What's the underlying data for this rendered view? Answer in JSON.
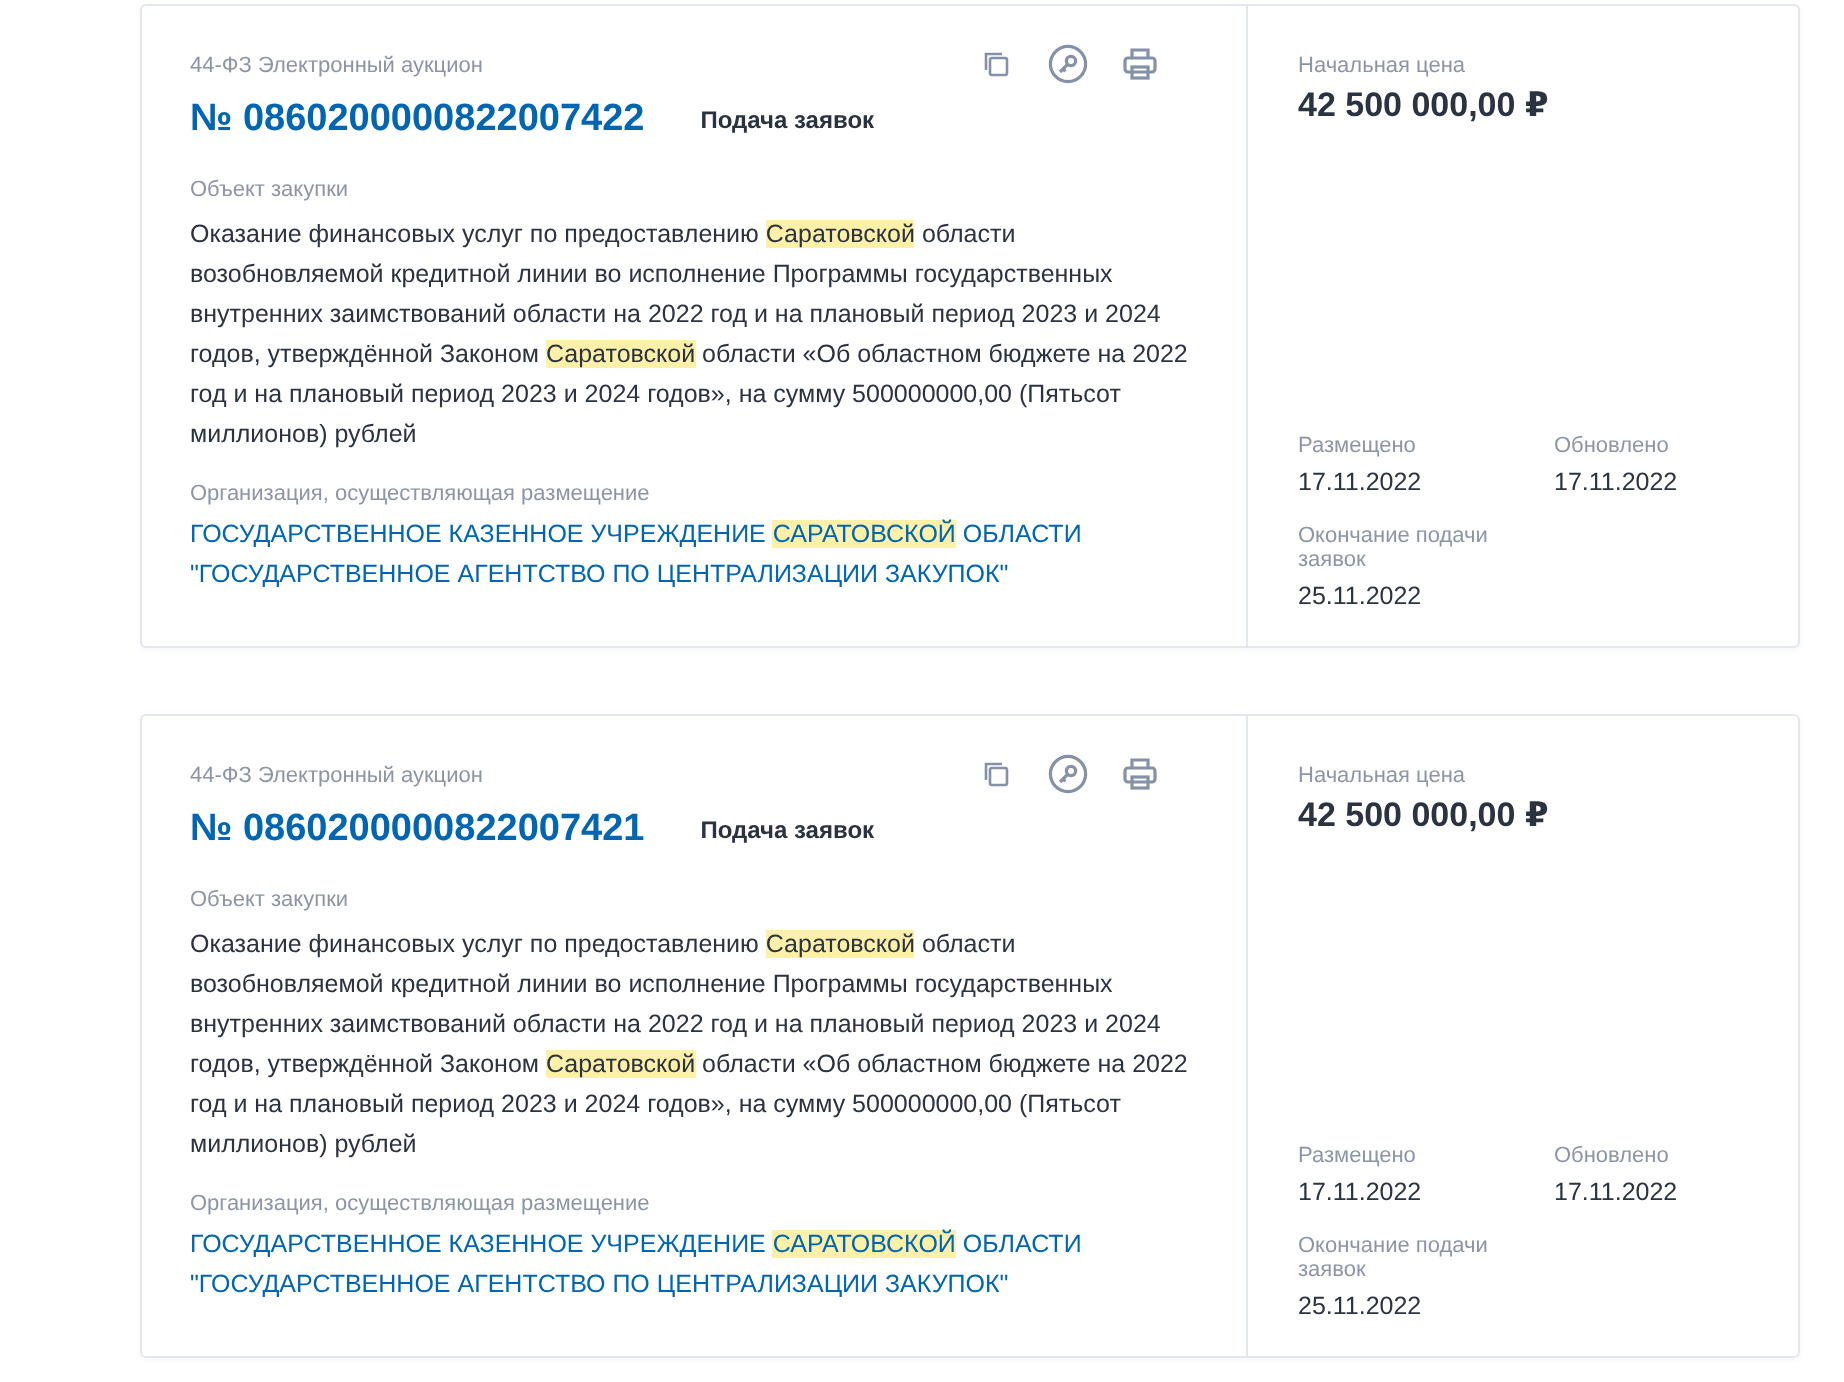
{
  "cards": [
    {
      "law_type": "44-ФЗ Электронный аукцион",
      "number": "№ 0860200000822007422",
      "stage": "Подача заявок",
      "object_label": "Объект закупки",
      "object": [
        {
          "text": "Оказание финансовых услуг по предоставлению ",
          "highlighted": false
        },
        {
          "text": "Саратовской",
          "highlighted": true
        },
        {
          "text": " области возобновляемой кредитной линии во исполнение Программы государственных внутренних заимствований области на 2022 год и на плановый период 2023 и 2024 годов, утверждённой Законом ",
          "highlighted": false
        },
        {
          "text": "Саратовской",
          "highlighted": true
        },
        {
          "text": " области «Об областном бюджете на 2022 год и на плановый период 2023 и 2024 годов», на сумму 500000000,00 (Пятьсот миллионов) рублей",
          "highlighted": false
        }
      ],
      "org_label": "Организация, осуществляющая размещение",
      "org": [
        {
          "text": "ГОСУДАРСТВЕННОЕ КАЗЕННОЕ УЧРЕЖДЕНИЕ ",
          "highlighted": false
        },
        {
          "text": "САРАТОВСКОЙ",
          "highlighted": true
        },
        {
          "text": " ОБЛАСТИ \"ГОСУДАРСТВЕННОЕ АГЕНТСТВО ПО ЦЕНТРАЛИЗАЦИИ ЗАКУПОК\"",
          "highlighted": false
        }
      ],
      "price_label": "Начальная цена",
      "price": "42 500 000,00 ₽",
      "posted_label": "Размещено",
      "posted": "17.11.2022",
      "updated_label": "Обновлено",
      "updated": "17.11.2022",
      "deadline_label": "Окончание подачи заявок",
      "deadline": "25.11.2022"
    },
    {
      "law_type": "44-ФЗ Электронный аукцион",
      "number": "№ 0860200000822007421",
      "stage": "Подача заявок",
      "object_label": "Объект закупки",
      "object": [
        {
          "text": "Оказание финансовых услуг по предоставлению ",
          "highlighted": false
        },
        {
          "text": "Саратовской",
          "highlighted": true
        },
        {
          "text": " области возобновляемой кредитной линии во исполнение Программы государственных внутренних заимствований области на 2022 год и на плановый период 2023 и 2024 годов, утверждённой Законом ",
          "highlighted": false
        },
        {
          "text": "Саратовской",
          "highlighted": true
        },
        {
          "text": " области «Об областном бюджете на 2022 год и на плановый период 2023 и 2024 годов», на сумму 500000000,00 (Пятьсот миллионов) рублей",
          "highlighted": false
        }
      ],
      "org_label": "Организация, осуществляющая размещение",
      "org": [
        {
          "text": "ГОСУДАРСТВЕННОЕ КАЗЕННОЕ УЧРЕЖДЕНИЕ ",
          "highlighted": false
        },
        {
          "text": "САРАТОВСКОЙ",
          "highlighted": true
        },
        {
          "text": " ОБЛАСТИ \"ГОСУДАРСТВЕННОЕ АГЕНТСТВО ПО ЦЕНТРАЛИЗАЦИИ ЗАКУПОК\"",
          "highlighted": false
        }
      ],
      "price_label": "Начальная цена",
      "price": "42 500 000,00 ₽",
      "posted_label": "Размещено",
      "posted": "17.11.2022",
      "updated_label": "Обновлено",
      "updated": "17.11.2022",
      "deadline_label": "Окончание подачи заявок",
      "deadline": "25.11.2022"
    }
  ]
}
